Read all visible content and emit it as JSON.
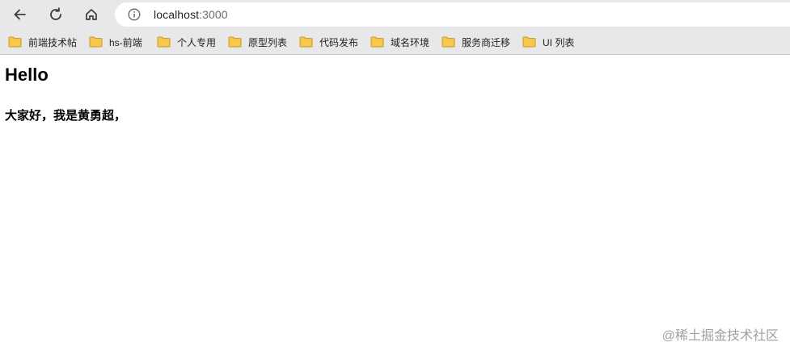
{
  "browser": {
    "url_host": "localhost",
    "url_port": ":3000",
    "icons": [
      "back-arrow-icon",
      "reload-icon",
      "home-icon",
      "info-icon",
      "folder-icon"
    ]
  },
  "bookmarks": [
    {
      "label": "前端技术帖"
    },
    {
      "label": "hs-前端"
    },
    {
      "label": "个人专用"
    },
    {
      "label": "原型列表"
    },
    {
      "label": "代码发布"
    },
    {
      "label": "域名环境"
    },
    {
      "label": "服务商迁移"
    },
    {
      "label": "UI 列表"
    }
  ],
  "page": {
    "heading": "Hello",
    "paragraph": "大家好，我是黄勇超，"
  },
  "watermark": "@稀土掘金技术社区",
  "colors": {
    "chrome_bg": "#e8e8ea",
    "folder_fill": "#f6c94e",
    "folder_stroke": "#c9961a"
  }
}
